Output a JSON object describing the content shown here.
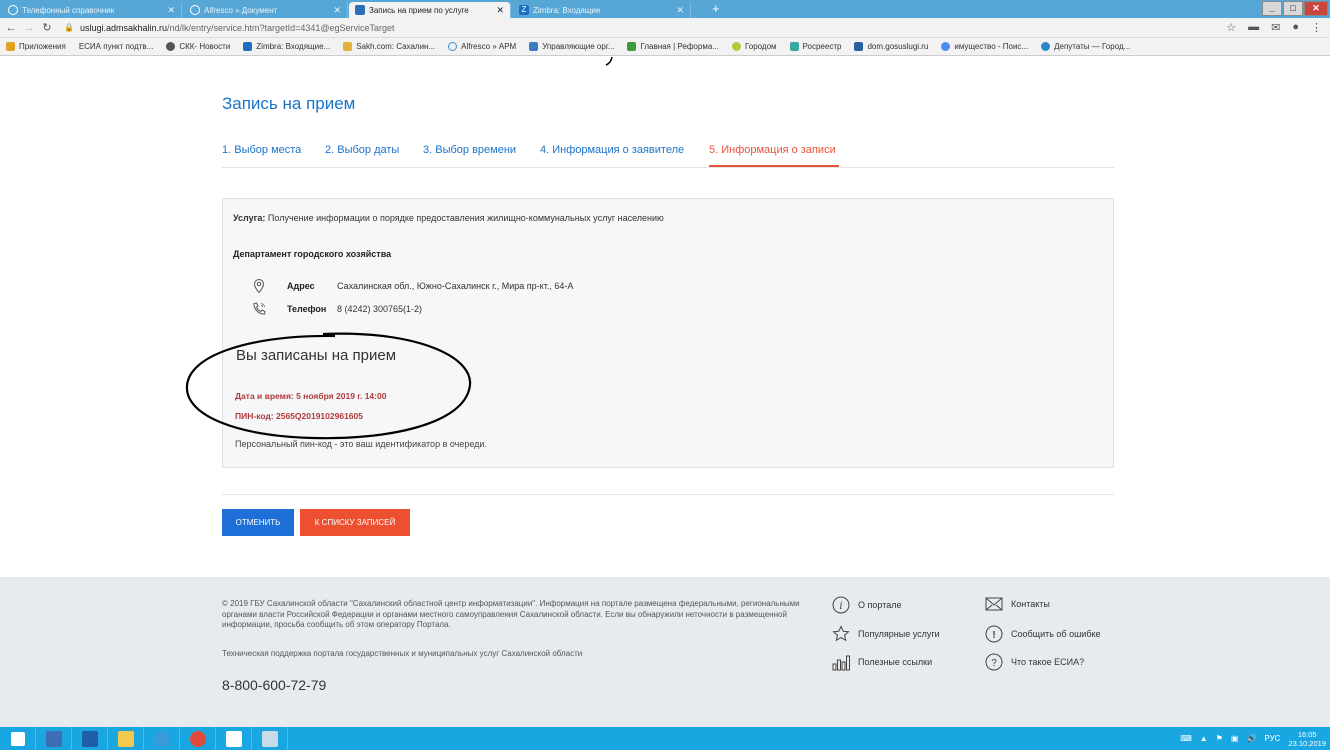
{
  "browser": {
    "tabs": [
      {
        "label": "Телефонный справочник",
        "active": false
      },
      {
        "label": "Alfresco » Документ",
        "active": false
      },
      {
        "label": "Запись на прием по услуге",
        "active": true
      },
      {
        "label": "Zimbra: Входящие",
        "active": false
      }
    ],
    "url_host": "uslugi.admsakhalin.ru",
    "url_path": "/nd/lk/entry/service.htm?targetId=4341@egServiceTarget",
    "bookmarks": [
      "Приложения",
      "ЕСИА пункт подтв...",
      "СКК- Новости",
      "Zimbra: Входящие...",
      "Sakh.com: Сахалин...",
      "Alfresco » АРМ",
      "Управляющие орг...",
      "Главная | Реформа...",
      "Городом",
      "Росреестр",
      "dom.gosuslugi.ru",
      "имущество - Поис...",
      "Депутаты — Город..."
    ]
  },
  "page": {
    "title": "Запись на прием",
    "steps": [
      "1. Выбор места",
      "2. Выбор даты",
      "3. Выбор времени",
      "4. Информация о заявителе",
      "5. Информация о записи"
    ],
    "active_step": 5
  },
  "card": {
    "service_label": "Услуга:",
    "service_value": "Получение информации о порядке предоставления жилищно-коммунальных услуг населению",
    "department": "Департамент городского хозяйства",
    "address_label": "Адрес",
    "address_value": "Сахалинская обл., Южно-Сахалинск г., Мира пр-кт., 64-А",
    "phone_label": "Телефон",
    "phone_value": "8 (4242) 300765(1-2)",
    "confirmed": "Вы записаны на прием",
    "datetime": "Дата и время: 5 ноября 2019 г. 14:00",
    "pin": "ПИН-код: 2565Q2019102961605",
    "pin_note": "Персональный пин-код - это ваш идентификатор в очереди."
  },
  "buttons": {
    "cancel": "ОТМЕНИТЬ",
    "to_list": "К СПИСКУ ЗАПИСЕЙ"
  },
  "footer": {
    "copyright": "© 2019 ГБУ Сахалинской области \"Сахалинский областной центр информатизации\". Информация на портале размещена федеральными, региональными органами власти Российской Федерации и органами местного самоуправления Сахалинской области. Если вы обнаружили неточности в размещенной информации, просьба сообщить об этом оператору Портала.",
    "support": "Техническая поддержка портала государственных и муниципальных услуг Сахалинской области",
    "phone": "8-800-600-72-79",
    "links": {
      "about": "О портале",
      "contacts": "Контакты",
      "popular": "Популярные услуги",
      "report": "Сообщить об ошибке",
      "useful": "Полезные ссылки",
      "esia": "Что такое ЕСИА?"
    }
  },
  "taskbar": {
    "lang": "РУС",
    "time": "16:05",
    "date": "23.10.2019"
  },
  "colors": {
    "link_blue": "#1a73c8",
    "active_red": "#e8543a",
    "button_blue": "#1f6fd8",
    "button_red": "#ed4f31",
    "pin_red": "#b03a3a"
  }
}
